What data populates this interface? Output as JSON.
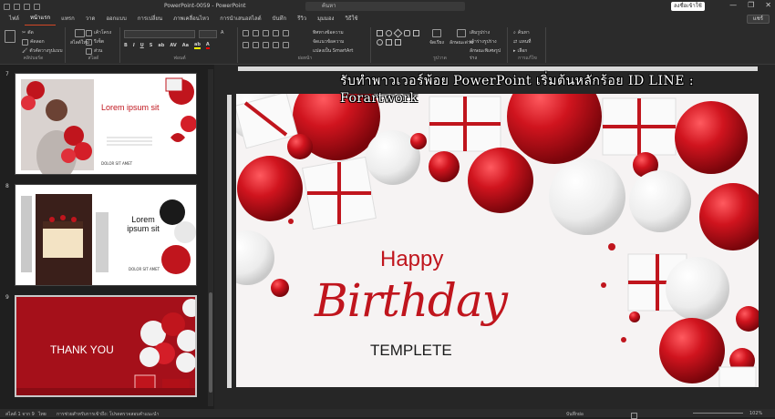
{
  "titlebar": {
    "title": "PowerPoint-0059  -  PowerPoint",
    "search_placeholder": "ค้นหา",
    "signin": "ลงชื่อเข้าใช้",
    "share": "แชร์"
  },
  "tabs": [
    "ไฟล์",
    "หน้าแรก",
    "แทรก",
    "วาด",
    "ออกแบบ",
    "การเปลี่ยน",
    "ภาพเคลื่อนไหว",
    "การนำเสนอสไลด์",
    "บันทึก",
    "รีวิว",
    "มุมมอง",
    "วิธีใช้"
  ],
  "ribbon": {
    "clipboard": {
      "cut": "ตัด",
      "copy": "คัดลอก",
      "format": "ตัวคัดวางรูปแบบ",
      "label": "คลิปบอร์ด"
    },
    "slides": {
      "new": "สไลด์ใหม่",
      "layout": "เค้าโครง",
      "reset": "รีเซ็ต",
      "section": "ส่วน",
      "reuse": "นำสไลด์กลับมาใช้ใหม่",
      "label": "สไลด์"
    },
    "font": {
      "label": "ฟอนต์"
    },
    "paragraph": {
      "direction": "ทิศทางข้อความ",
      "align": "จัดแนวข้อความ",
      "smartart": "แปลงเป็น SmartArt",
      "label": "ย่อหน้า"
    },
    "drawing": {
      "arrange": "จัดเรียง",
      "quick_styles": "ลักษณะด่วน",
      "fill": "เติมรูปร่าง",
      "outline": "เค้าร่างรูปร่าง",
      "effects": "ลักษณะพิเศษรูปร่าง",
      "label": "รูปวาด"
    },
    "editing": {
      "find": "ค้นหา",
      "replace": "แทนที่",
      "select": "เลือก",
      "label": "การแก้ไข"
    }
  },
  "slides": [
    {
      "num": "7",
      "title": "Lorem ipsum sit",
      "sub": "DOLOR SIT AMET"
    },
    {
      "num": "8",
      "title": "Lorem ipsum sit",
      "sub": "DOLOR SIT AMET"
    },
    {
      "num": "9",
      "title": "THANK YOU"
    }
  ],
  "watermark": "รับทำพาวเวอร์พ้อย PowerPoint เริ่มต้นหลักร้อย ID LINE : Forartwork",
  "main_slide": {
    "happy": "Happy",
    "birthday": "Birthday",
    "templete": "TEMPLETE"
  },
  "status": {
    "slide_of": "สไลด์ 1 จาก 9",
    "lang": "ไทย",
    "access": "การช่วยสำหรับการเข้าถึง: โปรดตรวจสอบคำแนะนำ",
    "notes": "บันทึกย่อ",
    "zoom": "102%"
  },
  "colors": {
    "accent": "#d24726",
    "red": "#c0151d",
    "dark": "#1f1f1f"
  }
}
